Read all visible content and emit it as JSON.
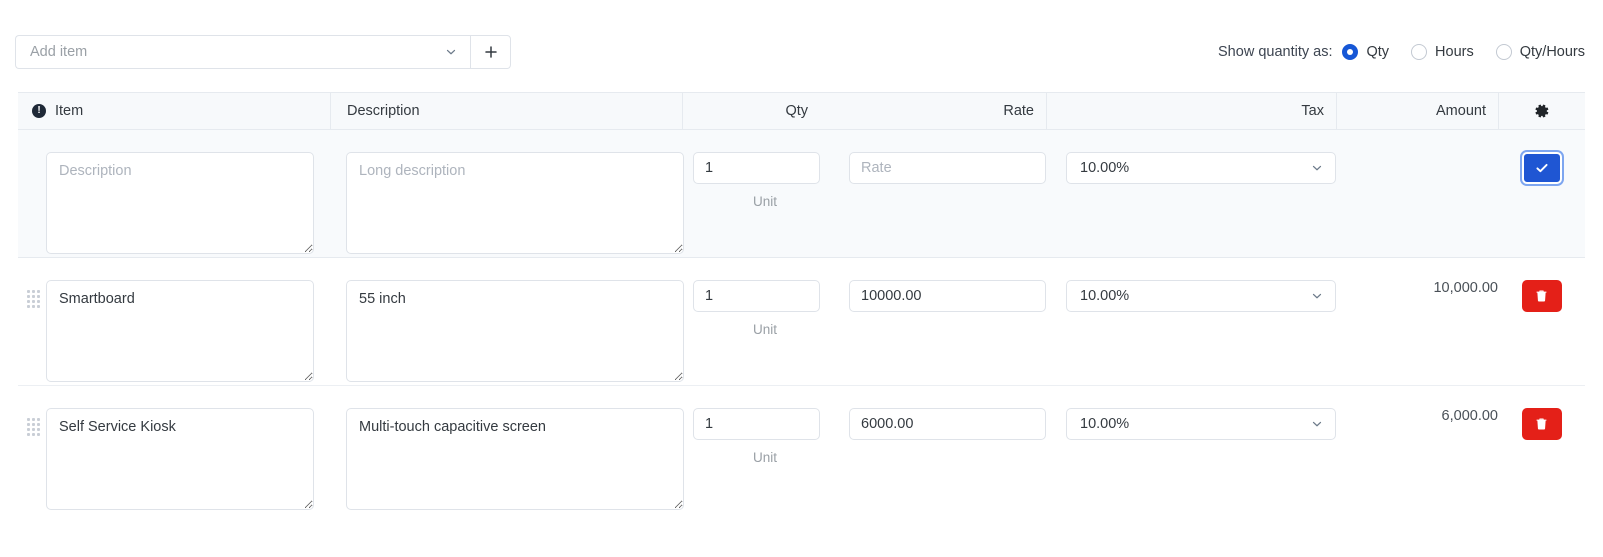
{
  "toolbar": {
    "add_item_placeholder": "Add item",
    "add_button_label": "+",
    "show_quantity_label": "Show quantity as:",
    "quantity_options": [
      {
        "label": "Qty",
        "selected": true
      },
      {
        "label": "Hours",
        "selected": false
      },
      {
        "label": "Qty/Hours",
        "selected": false
      }
    ]
  },
  "table": {
    "headers": {
      "item": "Item",
      "description": "Description",
      "qty": "Qty",
      "rate": "Rate",
      "tax": "Tax",
      "amount": "Amount",
      "settings_icon": "gear-icon"
    },
    "entry_row": {
      "item_placeholder": "Description",
      "item_value": "",
      "description_placeholder": "Long description",
      "description_value": "",
      "qty_value": "1",
      "qty_placeholder": "",
      "unit_label": "Unit",
      "rate_value": "",
      "rate_placeholder": "Rate",
      "tax_value": "10.00%",
      "amount": "",
      "action": "confirm"
    },
    "rows": [
      {
        "item": "Smartboard",
        "description": "55 inch",
        "qty": "1",
        "unit_label": "Unit",
        "rate": "10000.00",
        "tax": "10.00%",
        "amount": "10,000.00",
        "action": "delete"
      },
      {
        "item": "Self Service Kiosk",
        "description": "Multi-touch capacitive screen",
        "qty": "1",
        "unit_label": "Unit",
        "rate": "6000.00",
        "tax": "10.00%",
        "amount": "6,000.00",
        "action": "delete"
      }
    ]
  },
  "colors": {
    "accent_blue": "#1f56d3",
    "danger_red": "#e42018",
    "header_bg": "#f7f9fb",
    "entry_row_bg": "#f8fafc",
    "border": "#dfe3e9"
  }
}
